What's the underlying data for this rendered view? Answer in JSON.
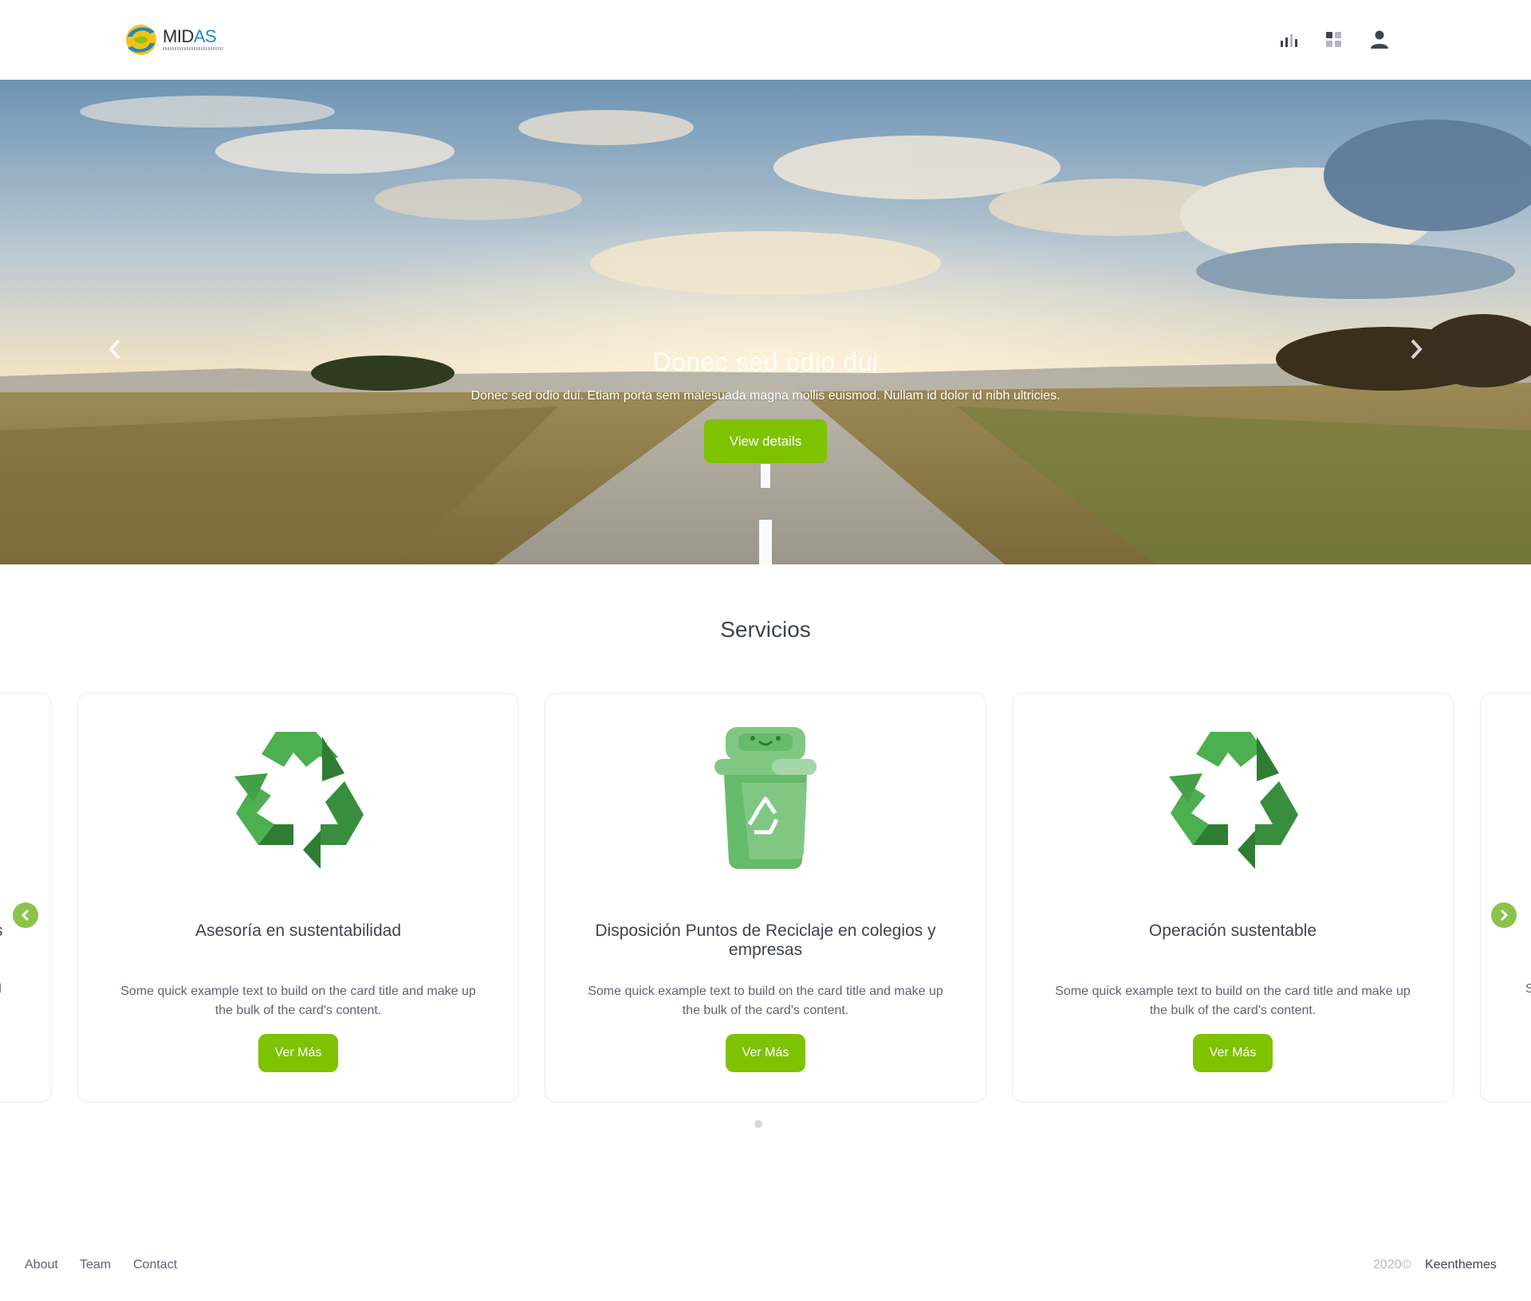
{
  "header": {
    "logo": {
      "text_dark": "MID",
      "text_blue": "AS",
      "icon": "midas-logo-icon"
    },
    "icons": [
      {
        "name": "chart-bar-icon"
      },
      {
        "name": "apps-grid-icon"
      },
      {
        "name": "user-icon"
      }
    ]
  },
  "hero": {
    "title": "Donec sed odio dui",
    "subtitle": "Donec sed odio dui. Etiam porta sem malesuada magna mollis euismod. Nullam id dolor id nibh ultricies.",
    "button": "View details",
    "prev_icon": "chevron-left-icon",
    "next_icon": "chevron-right-icon"
  },
  "services": {
    "title": "Servicios",
    "cards": [
      {
        "title": "Asesoría en sustentabilidad",
        "text": "Some quick example text to build on the card title and make up the bulk of the card's content.",
        "button": "Ver Más",
        "icon": "recycle-icon"
      },
      {
        "title": "Disposición Puntos de Reciclaje en colegios y empresas",
        "text": "Some quick example text to build on the card title and make up the bulk of the card's content.",
        "button": "Ver Más",
        "icon": "recycle-bin-icon"
      },
      {
        "title": "Operación sustentable",
        "text": "Some quick example text to build on the card title and make up the bulk of the card's content.",
        "button": "Ver Más",
        "icon": "recycle-icon"
      }
    ],
    "partial_left": {
      "title_frag": "s",
      "text_frag": "d"
    },
    "partial_right": {
      "text_frag": "S"
    },
    "prev_icon": "chevron-left-icon",
    "next_icon": "chevron-right-icon"
  },
  "footer": {
    "links": [
      "About",
      "Team",
      "Contact"
    ],
    "year": "2020©",
    "brand": "Keenthemes"
  },
  "colors": {
    "accent": "#7ec200",
    "arrow_green": "#8bc34a",
    "text": "#3f4254",
    "muted": "#5e6278"
  }
}
